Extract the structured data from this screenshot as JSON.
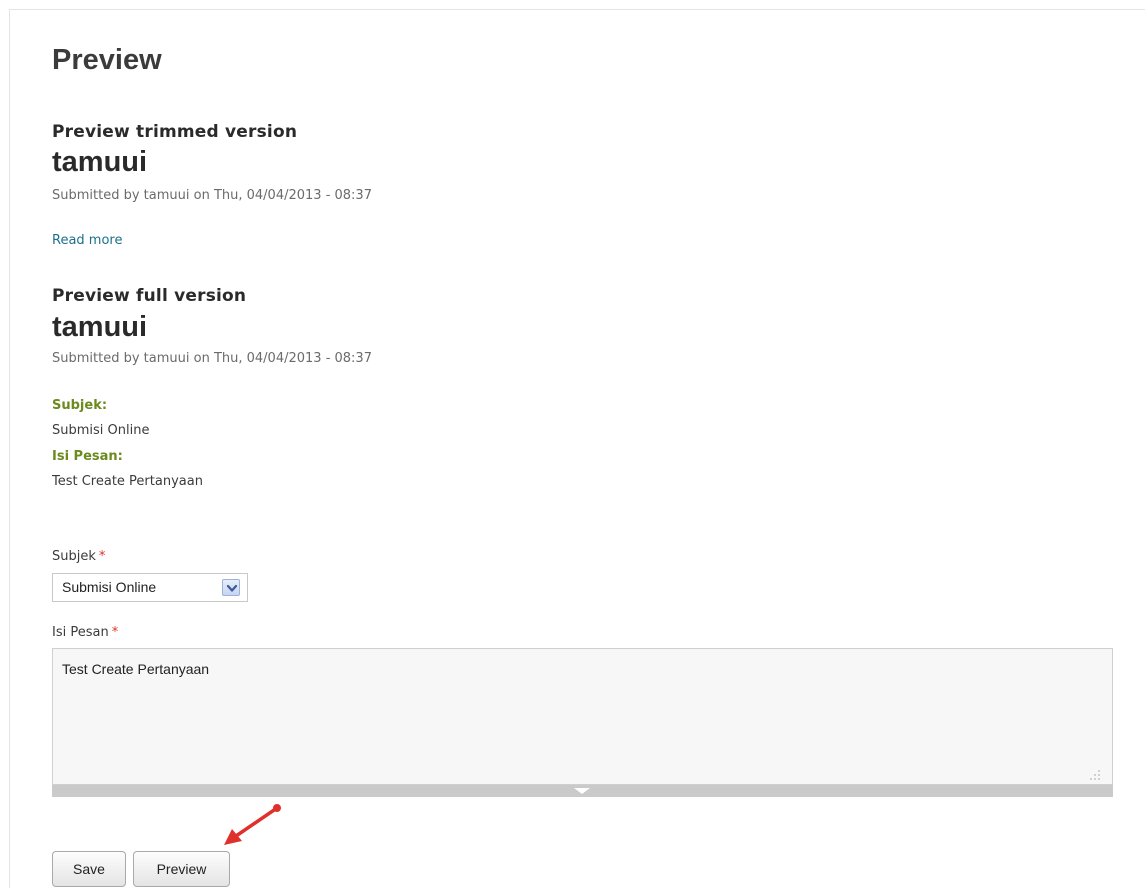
{
  "page": {
    "title": "Preview"
  },
  "trimmed": {
    "heading": "Preview trimmed version",
    "node_title": "tamuui",
    "submitted": "Submitted by tamuui on Thu, 04/04/2013 - 08:37",
    "read_more": "Read more"
  },
  "full": {
    "heading": "Preview full version",
    "node_title": "tamuui",
    "submitted": "Submitted by tamuui on Thu, 04/04/2013 - 08:37",
    "fields": [
      {
        "label": "Subjek:",
        "value": "Submisi Online"
      },
      {
        "label": "Isi Pesan:",
        "value": "Test Create Pertanyaan"
      }
    ]
  },
  "form": {
    "subjek": {
      "label": "Subjek",
      "required_mark": "*",
      "selected": "Submisi Online"
    },
    "isi_pesan": {
      "label": "Isi Pesan",
      "required_mark": "*",
      "value": "Test Create Pertanyaan"
    },
    "buttons": {
      "save": "Save",
      "preview": "Preview"
    }
  },
  "colors": {
    "field_label": "#6c8a1d",
    "link": "#1e6f8a",
    "required": "#e0302b",
    "annotation_arrow": "#e0302b"
  },
  "icons": {
    "select_arrow": "chevron-down-icon",
    "resize_grip": "resize-grip-icon",
    "annotation": "red-arrow-annotation-icon"
  }
}
